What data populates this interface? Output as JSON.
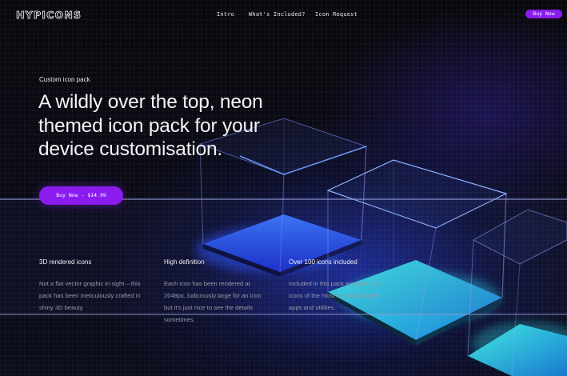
{
  "header": {
    "logo": "HYPICONS",
    "nav": [
      "Intro",
      "What's Included?",
      "Icon Request"
    ],
    "buy_button": "Buy Now"
  },
  "hero": {
    "eyebrow": "Custom icon pack",
    "headline": "A wildly over the top, neon themed icon pack for your device customisation.",
    "cta": "Buy Now - $14.99"
  },
  "features": [
    {
      "title": "3D rendered icons",
      "text": "Not a flat vector graphic in sight – this pack has been meticulously crafted in shiny 3D beauty."
    },
    {
      "title": "High definition",
      "text": "Each icon has been rendered at 2048px, ludicrously large for an icon but it's just nice to see the details sometimes."
    },
    {
      "title": "Over 100 icons included",
      "text": "Included in this pack are over 100 icons of the most commonly used apps and utilities."
    }
  ],
  "colors": {
    "accent": "#8a1cf0",
    "background": "#050508",
    "neon_blue": "#3a6bff",
    "neon_cyan": "#2fd8e8"
  }
}
